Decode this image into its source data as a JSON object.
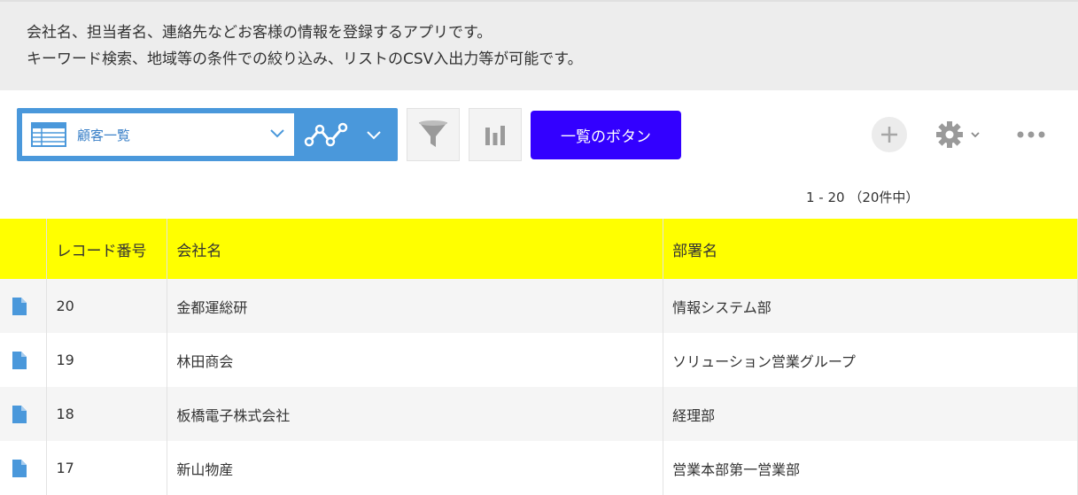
{
  "description": {
    "line1": "会社名、担当者名、連絡先などお客様の情報を登録するアプリです。",
    "line2": "キーワード検索、地域等の条件での絞り込み、リストのCSV入出力等が可能です。"
  },
  "toolbar": {
    "view_select_label": "顧客一覧",
    "custom_button_label": "一覧のボタン",
    "accent_color": "#4a98db",
    "custom_button_color": "#3300ff"
  },
  "pager": {
    "text": "1 - 20 （20件中）"
  },
  "table": {
    "header_color": "#ffff00",
    "columns": [
      "",
      "レコード番号",
      "会社名",
      "部署名"
    ],
    "rows": [
      {
        "id": "20",
        "company": "金都運総研",
        "department": "情報システム部"
      },
      {
        "id": "19",
        "company": "林田商会",
        "department": "ソリューション営業グループ"
      },
      {
        "id": "18",
        "company": "板橋電子株式会社",
        "department": "経理部"
      },
      {
        "id": "17",
        "company": "新山物産",
        "department": "営業本部第一営業部"
      }
    ]
  },
  "icons": [
    "table-view-icon",
    "chevron-down-icon",
    "graph-icon",
    "filter-icon",
    "bar-chart-icon",
    "plus-icon",
    "gear-icon",
    "more-icon",
    "document-icon"
  ]
}
